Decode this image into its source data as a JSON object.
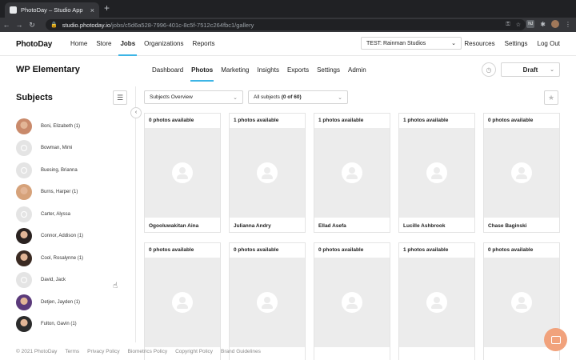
{
  "browser": {
    "tab_title": "PhotoDay – Studio App",
    "tab_close": "×",
    "new_tab": "+",
    "url_host": "studio.photoday.io",
    "url_path": "/jobs/c5d6a528-7996-401c-8c5f-7512c264fbc1/gallery",
    "ext_label": "NJ"
  },
  "header": {
    "logo": "PhotoDay",
    "nav": [
      "Home",
      "Store",
      "Jobs",
      "Organizations",
      "Reports"
    ],
    "active_nav": "Jobs",
    "studio_select": "TEST: Rainman Studios",
    "right_nav": [
      "Resources",
      "Settings",
      "Log Out"
    ]
  },
  "job": {
    "title": "WP Elementary",
    "tabs": [
      "Dashboard",
      "Photos",
      "Marketing",
      "Insights",
      "Exports",
      "Settings",
      "Admin"
    ],
    "active_tab": "Photos",
    "status": "Draft"
  },
  "sidebar": {
    "title": "Subjects",
    "subjects": [
      {
        "name": "Boni, Elizabeth (1)",
        "has_photo": true,
        "tone": "#c98a6b"
      },
      {
        "name": "Bowman, Mimi",
        "has_photo": false
      },
      {
        "name": "Buesing, Brianna",
        "has_photo": false
      },
      {
        "name": "Burns, Harper (1)",
        "has_photo": true,
        "tone": "#d6a27a"
      },
      {
        "name": "Carter, Alyssa",
        "has_photo": false
      },
      {
        "name": "Connor, Addison (1)",
        "has_photo": true,
        "tone": "#2a2220"
      },
      {
        "name": "Cool, Rosalynne (1)",
        "has_photo": true,
        "tone": "#3a2a22"
      },
      {
        "name": "David, Jack",
        "has_photo": false
      },
      {
        "name": "Detjen, Jayden (1)",
        "has_photo": true,
        "tone": "#5b3a7a"
      },
      {
        "name": "Fulton, Gavin (1)",
        "has_photo": true,
        "tone": "#2b2b2b"
      }
    ]
  },
  "filters": {
    "overview": "Subjects Overview",
    "all_subjects": "All subjects",
    "all_subjects_count": "(0 of 60)"
  },
  "gallery": {
    "cards": [
      {
        "count": "0 photos available",
        "name": "Ogooluwakitan Aina"
      },
      {
        "count": "1 photos available",
        "name": "Julianna Andry"
      },
      {
        "count": "1 photos available",
        "name": "Ellad Asefa"
      },
      {
        "count": "1 photos available",
        "name": "Lucille Ashbrook"
      },
      {
        "count": "0 photos available",
        "name": "Chase Baginski"
      },
      {
        "count": "0 photos available",
        "name": ""
      },
      {
        "count": "0 photos available",
        "name": ""
      },
      {
        "count": "0 photos available",
        "name": ""
      },
      {
        "count": "1 photos available",
        "name": ""
      },
      {
        "count": "0 photos available",
        "name": ""
      }
    ]
  },
  "footer": {
    "links": [
      "© 2021 PhotoDay",
      "Terms",
      "Privacy Policy",
      "Biometrics Policy",
      "Copyright Policy",
      "Brand Guidelines"
    ]
  },
  "colors": {
    "accent": "#3db5e6",
    "chat": "#f1a27c"
  }
}
